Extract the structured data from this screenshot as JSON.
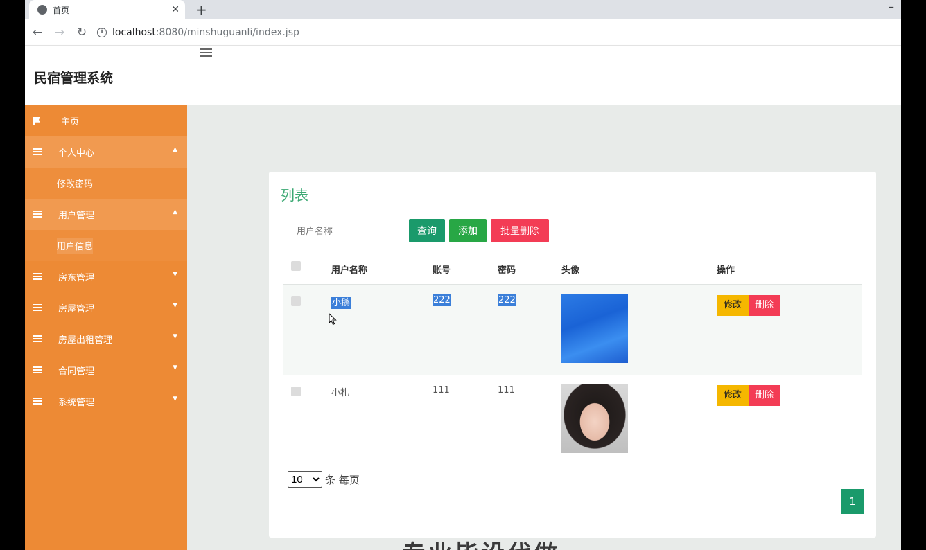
{
  "browser": {
    "tab_title": "首页",
    "tab_close": "✕",
    "new_tab": "+",
    "minimize": "–",
    "url_host": "localhost",
    "url_rest": ":8080/minshuguanli/index.jsp"
  },
  "header": {
    "title": "民宿管理系统"
  },
  "sidebar": {
    "home": "主页",
    "items": [
      {
        "label": "个人中心",
        "sub": [
          "修改密码"
        ]
      },
      {
        "label": "用户管理",
        "sub": [
          "用户信息"
        ]
      },
      {
        "label": "房东管理"
      },
      {
        "label": "房屋管理"
      },
      {
        "label": "房屋出租管理"
      },
      {
        "label": "合同管理"
      },
      {
        "label": "系统管理"
      }
    ]
  },
  "panel": {
    "title": "列表",
    "search_placeholder": "用户名称",
    "query_label": "查询",
    "add_label": "添加",
    "batch_delete_label": "批量删除"
  },
  "table": {
    "headers": [
      "用户名称",
      "账号",
      "密码",
      "头像",
      "操作"
    ],
    "rows": [
      {
        "username": "小鹅",
        "account": "222",
        "password": "222",
        "avatar": "blue"
      },
      {
        "username": "小札",
        "account": "111",
        "password": "111",
        "avatar": "photo"
      }
    ],
    "edit_label": "修改",
    "delete_label": "删除"
  },
  "pagination": {
    "page_size": "10",
    "page_size_suffix": "条 每页",
    "current_page": "1"
  },
  "watermark": "专业毕设代做"
}
